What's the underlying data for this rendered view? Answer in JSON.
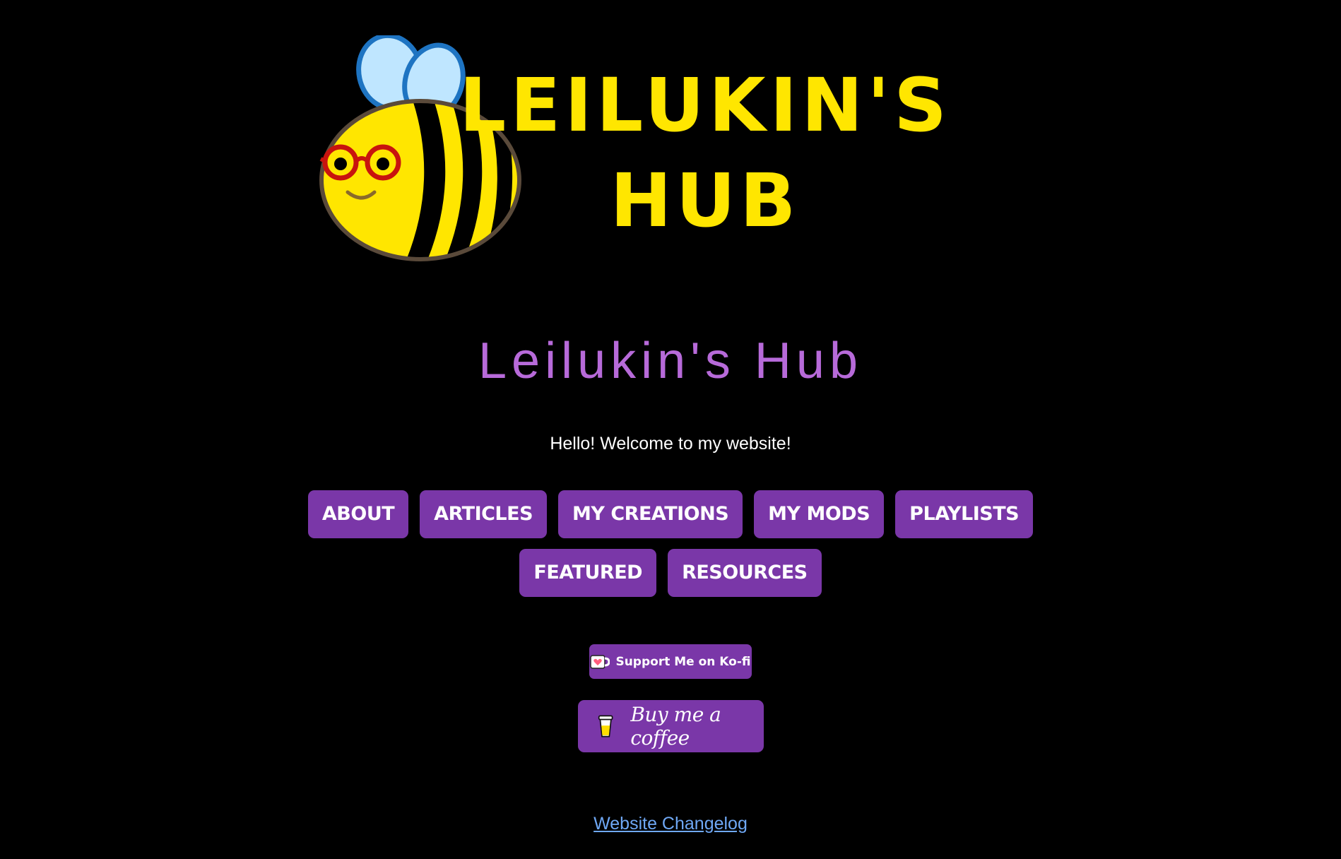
{
  "logo": {
    "line1": "LEILUKIN'S",
    "line2": "HUB",
    "icon": "bee-icon"
  },
  "header": {
    "title": "Leilukin's Hub",
    "welcome": "Hello! Welcome to my website!"
  },
  "nav": {
    "row1": [
      "ABOUT",
      "ARTICLES",
      "MY CREATIONS",
      "MY MODS",
      "PLAYLISTS"
    ],
    "row2": [
      "FEATURED",
      "RESOURCES"
    ]
  },
  "support": {
    "kofi_label": "Support Me on Ko-fi",
    "kofi_icon": "kofi-cup-icon",
    "bmc_label": "Buy me a coffee",
    "bmc_icon": "coffee-cup-icon"
  },
  "footer": {
    "changelog_label": "Website Changelog"
  },
  "colors": {
    "background": "#000000",
    "title": "#b76ad9",
    "button": "#7a37a8",
    "logo_text": "#ffe600",
    "link": "#6fa8f5"
  }
}
